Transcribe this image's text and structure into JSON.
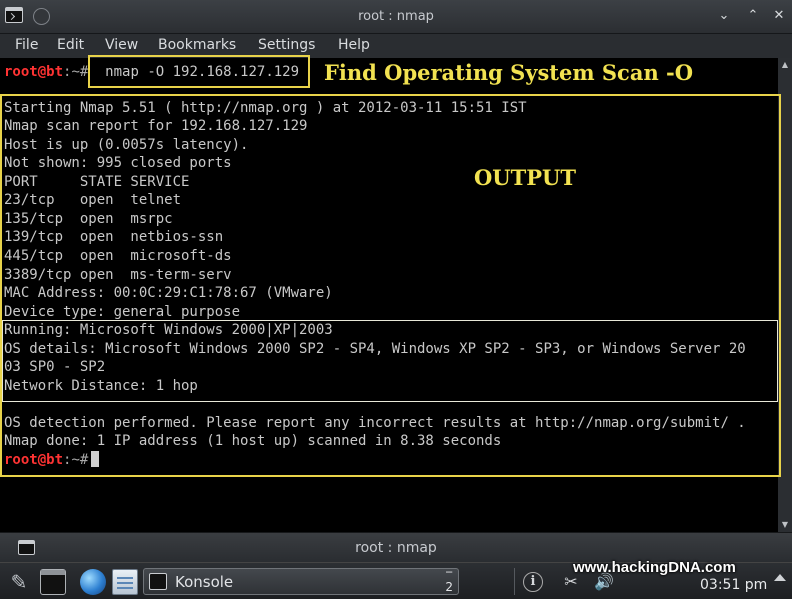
{
  "window": {
    "title": "root : nmap",
    "minimize_glyph": "⌄",
    "maximize_glyph": "⌃",
    "close_glyph": "✕"
  },
  "menu": [
    "File",
    "Edit",
    "View",
    "Bookmarks",
    "Settings",
    "Help"
  ],
  "prompt": {
    "user": "root@bt",
    "path": ":~#"
  },
  "command": "nmap -O 192.168.127.129",
  "annotations": {
    "command_label": "Find Operating System Scan -O",
    "output_label": "OUTPUT"
  },
  "output_lines": [
    "Starting Nmap 5.51 ( http://nmap.org ) at 2012-03-11 15:51 IST",
    "Nmap scan report for 192.168.127.129",
    "Host is up (0.0057s latency).",
    "Not shown: 995 closed ports",
    "PORT     STATE SERVICE",
    "23/tcp   open  telnet",
    "135/tcp  open  msrpc",
    "139/tcp  open  netbios-ssn",
    "445/tcp  open  microsoft-ds",
    "3389/tcp open  ms-term-serv",
    "MAC Address: 00:0C:29:C1:78:67 (VMware)",
    "Device type: general purpose",
    "Running: Microsoft Windows 2000|XP|2003",
    "OS details: Microsoft Windows 2000 SP2 - SP4, Windows XP SP2 - SP3, or Windows Server 20",
    "03 SP0 - SP2",
    "Network Distance: 1 hop",
    "",
    "OS detection performed. Please report any incorrect results at http://nmap.org/submit/ .",
    "Nmap done: 1 IP address (1 host up) scanned in 8.38 seconds"
  ],
  "second_window": {
    "title": "root : nmap"
  },
  "taskbar": {
    "task_label": "Konsole",
    "task_count": "2",
    "clock": "03:51 pm",
    "watermark": "www.hackingDNA.com",
    "icons": [
      "kde-menu-icon",
      "terminal-icon",
      "globe-icon",
      "notes-icon",
      "info-icon",
      "scissors-icon",
      "volume-icon"
    ]
  },
  "colors": {
    "prompt_user": "#ff3333",
    "annotation": "#f2e251",
    "terminal_bg": "#000000",
    "terminal_fg": "#c8c8c8"
  }
}
